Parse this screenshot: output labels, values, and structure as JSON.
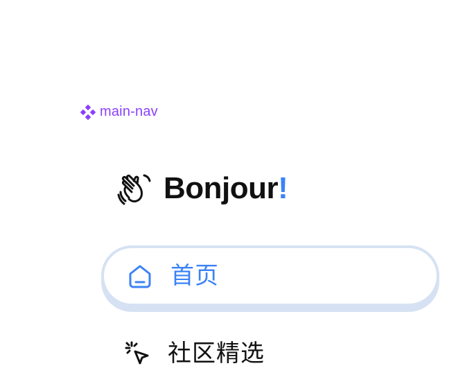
{
  "component_tag": {
    "icon": "component-diamond-icon",
    "label": "main-nav",
    "color": "#8a3ffc"
  },
  "greeting": {
    "icon": "waving-hand-icon",
    "title": "Bonjour",
    "punctuation": "!",
    "accent_color": "#3b82f6"
  },
  "nav": {
    "items": [
      {
        "icon": "home-icon",
        "label": "首页",
        "active": true
      },
      {
        "icon": "cursor-click-icon",
        "label": "社区精选",
        "active": false
      }
    ],
    "active_color": "#3b82f6",
    "active_border_color": "#d6e2f3"
  }
}
